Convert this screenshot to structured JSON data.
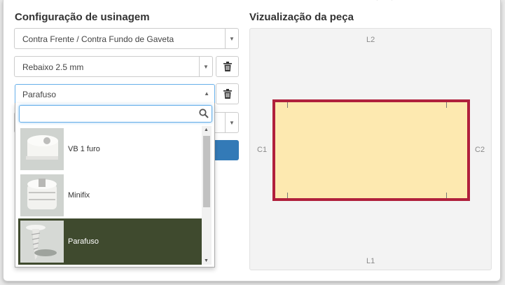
{
  "config": {
    "title": "Configuração de usinagem",
    "select1": {
      "value": "Contra Frente / Contra Fundo de Gaveta"
    },
    "select2": {
      "value": "Rebaixo 2.5 mm"
    },
    "select3": {
      "value": "Parafuso"
    }
  },
  "dropdown": {
    "search_value": "",
    "options": [
      {
        "label": "VB 1 furo",
        "selected": false
      },
      {
        "label": "Minifix",
        "selected": false
      },
      {
        "label": "Parafuso",
        "selected": true
      }
    ]
  },
  "preview": {
    "title": "Vizualização da peça",
    "edges": {
      "top": "L2",
      "bottom": "L1",
      "left": "C1",
      "right": "C2"
    }
  },
  "colors": {
    "piece_fill": "#fde9b0",
    "piece_border": "#b0203c",
    "selected_option": "#3f4a2e",
    "primary_button": "#337ab7"
  },
  "icons": [
    "chevron-down-icon",
    "chevron-up-icon",
    "trash-icon",
    "search-icon"
  ]
}
